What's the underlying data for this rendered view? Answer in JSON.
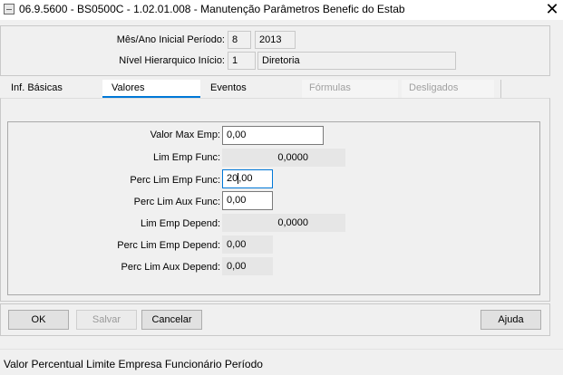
{
  "window": {
    "title": "06.9.5600 - BS0500C - 1.02.01.008 - Manutenção Parâmetros Benefic do Estab",
    "close_glyph": "✕"
  },
  "header": {
    "period_label": "Mês/Ano Inicial Período:",
    "period_month": "8",
    "period_year": "2013",
    "level_label": "Nível Hierarquico Início:",
    "level_code": "1",
    "level_name": "Diretoria"
  },
  "tabs": [
    {
      "label": "Inf. Básicas",
      "state": "normal"
    },
    {
      "label": "Valores",
      "state": "active"
    },
    {
      "label": "Eventos",
      "state": "normal"
    },
    {
      "label": "Fórmulas",
      "state": "disabled"
    },
    {
      "label": "Desligados",
      "state": "disabled"
    }
  ],
  "fields": {
    "valor_max_emp": {
      "label": "Valor Max Emp:",
      "value": "0,00"
    },
    "lim_emp_func": {
      "label": "Lim Emp Func:",
      "value": "0,0000"
    },
    "perc_lim_emp_func": {
      "label": "Perc Lim Emp Func:",
      "value_before_caret": "20",
      "value_after_caret": ",00"
    },
    "perc_lim_aux_func": {
      "label": "Perc Lim Aux Func:",
      "value": "0,00"
    },
    "lim_emp_depend": {
      "label": "Lim Emp Depend:",
      "value": "0,0000"
    },
    "perc_lim_emp_depend": {
      "label": "Perc Lim Emp Depend:",
      "value": "0,00"
    },
    "perc_lim_aux_depend": {
      "label": "Perc Lim Aux Depend:",
      "value": "0,00"
    }
  },
  "buttons": {
    "ok": "OK",
    "salvar": "Salvar",
    "cancelar": "Cancelar",
    "ajuda": "Ajuda"
  },
  "status_bar": {
    "text": "Valor Percentual Limite Empresa Funcionário Período"
  },
  "colors": {
    "accent": "#0078d7",
    "background": "#f0f0f0"
  }
}
